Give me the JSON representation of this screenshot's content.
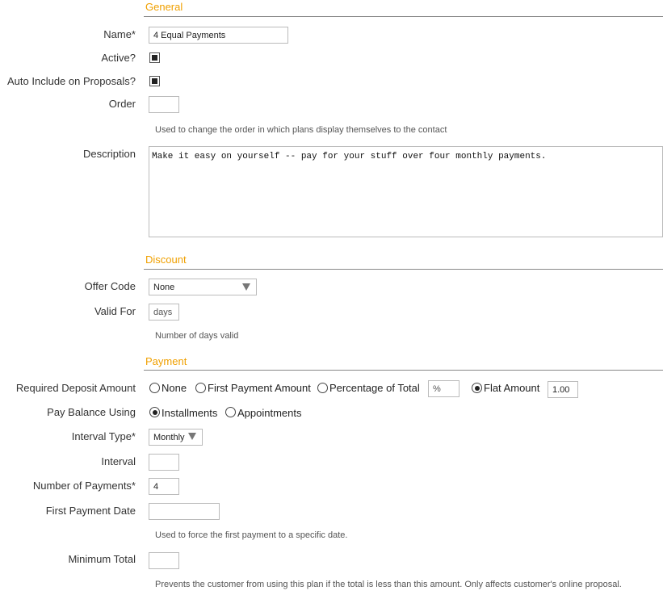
{
  "general": {
    "section_title": "General",
    "name": {
      "label": "Name*",
      "value": "4 Equal Payments"
    },
    "active": {
      "label": "Active?",
      "checked": true
    },
    "auto_include": {
      "label": "Auto Include on Proposals?",
      "checked": true
    },
    "order": {
      "label": "Order",
      "value": "",
      "hint": "Used to change the order in which plans display themselves to the contact"
    },
    "description": {
      "label": "Description",
      "value": "Make it easy on yourself -- pay for your stuff over four monthly payments."
    }
  },
  "discount": {
    "section_title": "Discount",
    "offer_code": {
      "label": "Offer Code",
      "selected": "None"
    },
    "valid_for": {
      "label": "Valid For",
      "placeholder": "days",
      "hint": "Number of days valid"
    }
  },
  "payment": {
    "section_title": "Payment",
    "required_deposit": {
      "label": "Required Deposit Amount",
      "options": [
        "None",
        "First Payment Amount",
        "Percentage of Total",
        "Flat Amount"
      ],
      "selected": "Flat Amount",
      "percentage_placeholder": "%",
      "flat_amount_value": "1.00"
    },
    "pay_balance": {
      "label": "Pay Balance Using",
      "options": [
        "Installments",
        "Appointments"
      ],
      "selected": "Installments"
    },
    "interval_type": {
      "label": "Interval Type*",
      "selected": "Monthly"
    },
    "interval": {
      "label": "Interval",
      "value": ""
    },
    "number_of_payments": {
      "label": "Number of Payments*",
      "value": "4"
    },
    "first_payment_date": {
      "label": "First Payment Date",
      "value": "",
      "hint": "Used to force the first payment to a specific date."
    },
    "minimum_total": {
      "label": "Minimum Total",
      "value": "",
      "hint": "Prevents the customer from using this plan if the total is less than this amount. Only affects customer's online proposal."
    }
  },
  "icons": {
    "dropdown": "chevron-down-icon",
    "checkbox": "checkbox-icon",
    "radio": "radio-icon"
  },
  "colors": {
    "section_title": "#f0a000",
    "rule": "#888888",
    "border": "#bbbbbb"
  }
}
